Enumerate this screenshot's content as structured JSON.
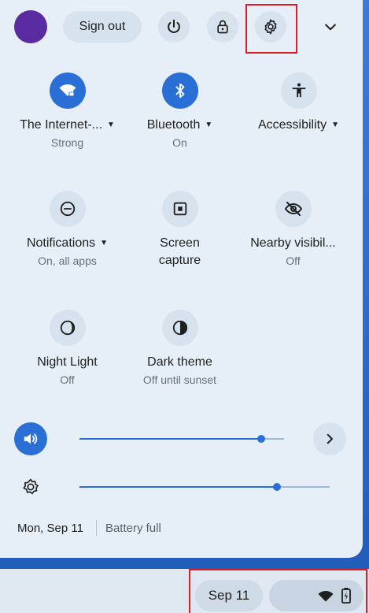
{
  "topbar": {
    "sign_out_label": "Sign out",
    "buttons": [
      "power-icon",
      "lock-icon",
      "gear-icon",
      "chevron-down-icon"
    ]
  },
  "tiles": [
    {
      "label": "The Internet-...",
      "sub": "Strong",
      "icon": "wifi-lock-icon",
      "on": true,
      "dropdown": true
    },
    {
      "label": "Bluetooth",
      "sub": "On",
      "icon": "bluetooth-icon",
      "on": true,
      "dropdown": true
    },
    {
      "label": "Accessibility",
      "sub": "",
      "icon": "accessibility-icon",
      "on": false,
      "dropdown": true
    },
    {
      "label": "Notifications",
      "sub": "On, all apps",
      "icon": "do-not-disturb-icon",
      "on": false,
      "dropdown": true
    },
    {
      "label_line1": "Screen",
      "label_line2": "capture",
      "icon": "screen-capture-icon",
      "on": false,
      "dropdown": false
    },
    {
      "label": "Nearby visibil...",
      "sub": "Off",
      "icon": "visibility-off-icon",
      "on": false,
      "dropdown": false
    },
    {
      "label": "Night Light",
      "sub": "Off",
      "icon": "night-light-icon",
      "on": false,
      "dropdown": false
    },
    {
      "label": "Dark theme",
      "sub": "Off until sunset",
      "icon": "dark-theme-icon",
      "on": false,
      "dropdown": false
    }
  ],
  "sliders": {
    "volume": {
      "icon": "speaker-icon",
      "level": 0.89
    },
    "brightness": {
      "icon": "brightness-icon",
      "level": 0.79
    }
  },
  "footer": {
    "date": "Mon, Sep 11",
    "battery": "Battery full"
  },
  "shelf": {
    "date": "Sep 11",
    "icons": [
      "wifi-icon",
      "battery-icon"
    ]
  },
  "colors": {
    "accent": "#2a6fd6",
    "panel": "#e6eef7",
    "highlight": "#e01b24",
    "avatar": "#5a2aa0"
  }
}
